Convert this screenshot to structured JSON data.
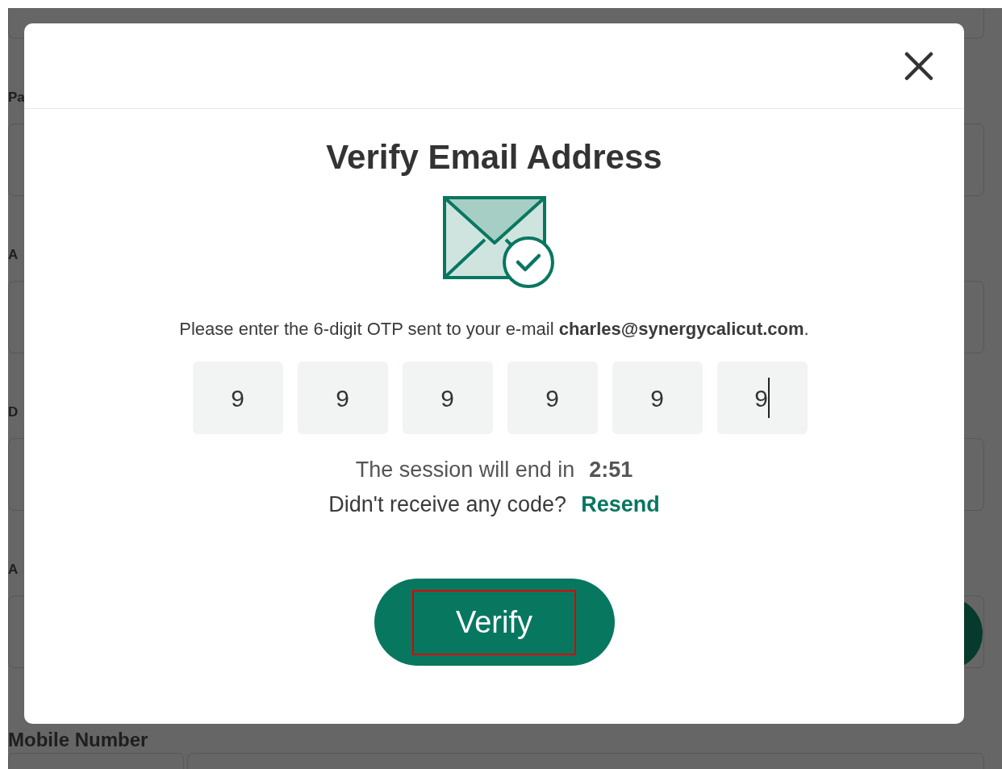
{
  "background_form": {
    "labels": [
      "Pa",
      "A",
      "D",
      "A"
    ],
    "mobile_label": "Mobile Number"
  },
  "dialog": {
    "title": "Verify Email Address",
    "message": "Please enter the 6-digit OTP sent to your e-mail **charles@synergycalicut.com**.",
    "otp": [
      {
        "value": "9",
        "focused": false
      },
      {
        "value": "9",
        "focused": false
      },
      {
        "value": "9",
        "focused": false
      },
      {
        "value": "9",
        "focused": false
      },
      {
        "value": "9",
        "focused": false
      },
      {
        "value": "9",
        "focused": true
      }
    ],
    "session_label": "The session will end in",
    "session_time": "2:51",
    "resend_prompt": "Didn't receive any code?",
    "resend_link": "Resend",
    "verify_button": {
      "label": "Verify",
      "highlighted": true
    }
  }
}
